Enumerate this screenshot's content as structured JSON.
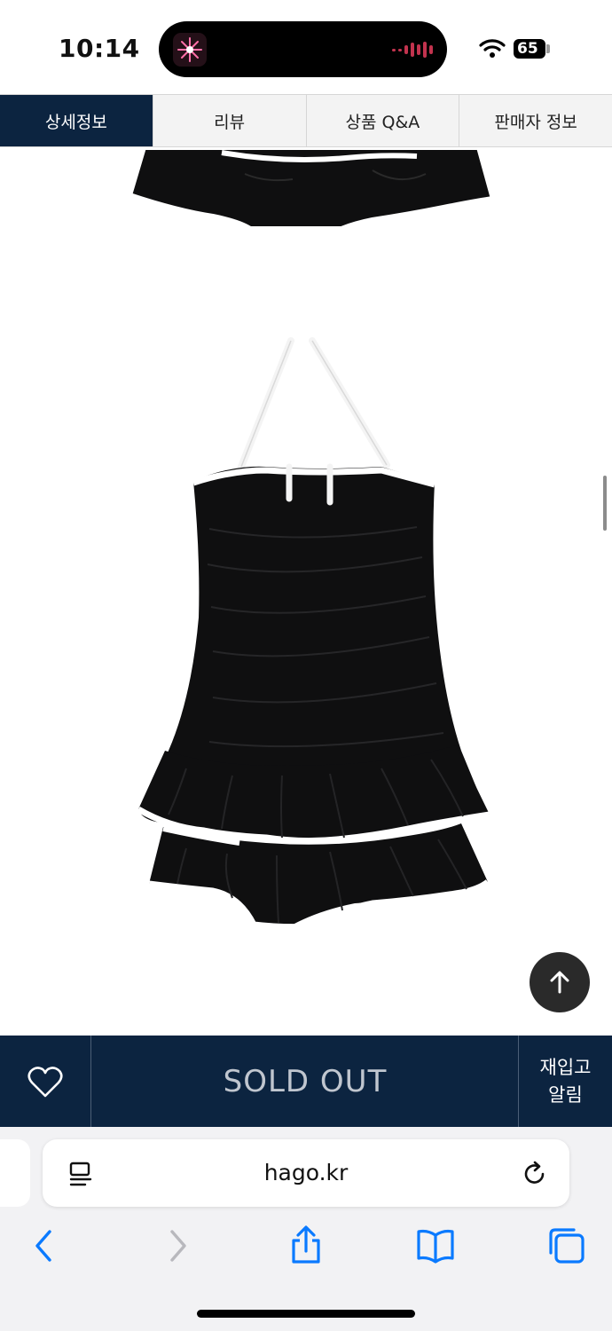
{
  "status_bar": {
    "time": "10:14",
    "battery": "65"
  },
  "tabs": [
    {
      "label": "상세정보",
      "active": true
    },
    {
      "label": "리뷰"
    },
    {
      "label": "상품 Q&A"
    },
    {
      "label": "판매자 정보"
    }
  ],
  "action_bar": {
    "status_label": "SOLD OUT",
    "restock_line1": "재입고",
    "restock_line2": "알림"
  },
  "browser": {
    "url": "hago.kr"
  },
  "colors": {
    "navy": "#0c2440",
    "dress": "#0f0f10",
    "trim": "#ffffff"
  }
}
